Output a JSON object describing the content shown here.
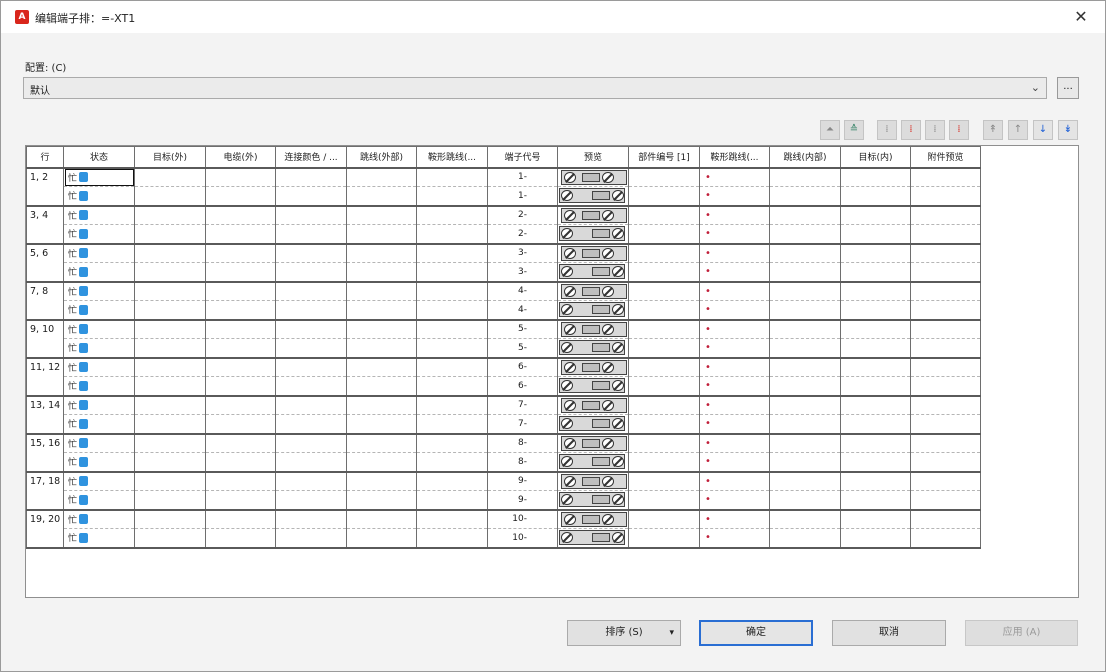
{
  "window": {
    "title": "编辑端子排：=-XT1",
    "app_icon_glyph": "A",
    "close_glyph": "✕"
  },
  "config": {
    "label": "配置: (C)",
    "selected": "默认",
    "chevron": "⌄",
    "more_label": "..."
  },
  "toolbar": [
    {
      "name": "move-top-icon",
      "glyph": "⏶",
      "tone": "gray"
    },
    {
      "name": "align-icon",
      "glyph": "≙",
      "tone": "teal"
    },
    {
      "name": "split-col-icon",
      "glyph": "⁞",
      "tone": "gray"
    },
    {
      "name": "insert-red-icon",
      "glyph": "⁞",
      "tone": "red"
    },
    {
      "name": "column-icon",
      "glyph": "⁞",
      "tone": "gray"
    },
    {
      "name": "delete-red-icon",
      "glyph": "⁞",
      "tone": "red"
    },
    {
      "name": "up-first-icon",
      "glyph": "↟",
      "tone": "gray"
    },
    {
      "name": "up-icon",
      "glyph": "↑",
      "tone": "gray"
    },
    {
      "name": "down-icon",
      "glyph": "↓",
      "tone": "blue"
    },
    {
      "name": "down-last-icon",
      "glyph": "↡",
      "tone": "blue"
    }
  ],
  "table": {
    "headers": [
      "行",
      "状态",
      "目标(外)",
      "电缆(外)",
      "连接颜色 / ...",
      "跳线(外部)",
      "鞍形跳线(...",
      "端子代号",
      "预览",
      "部件编号 [1]",
      "鞍形跳线(...",
      "跳线(内部)",
      "目标(内)",
      "附件预览"
    ],
    "status_glyph": "忙",
    "dot_glyph": "•",
    "rows": [
      {
        "label": "1, 2",
        "codes": [
          "1-",
          "1-"
        ]
      },
      {
        "label": "3, 4",
        "codes": [
          "2-",
          "2-"
        ]
      },
      {
        "label": "5, 6",
        "codes": [
          "3-",
          "3-"
        ]
      },
      {
        "label": "7, 8",
        "codes": [
          "4-",
          "4-"
        ]
      },
      {
        "label": "9, 10",
        "codes": [
          "5-",
          "5-"
        ]
      },
      {
        "label": "11, 12",
        "codes": [
          "6-",
          "6-"
        ]
      },
      {
        "label": "13, 14",
        "codes": [
          "7-",
          "7-"
        ]
      },
      {
        "label": "15, 16",
        "codes": [
          "8-",
          "8-"
        ]
      },
      {
        "label": "17, 18",
        "codes": [
          "9-",
          "9-"
        ]
      },
      {
        "label": "19, 20",
        "codes": [
          "10-",
          "10-"
        ]
      }
    ]
  },
  "buttons": {
    "sort": "排序 (S)",
    "sort_arrow": "▾",
    "ok": "确定",
    "cancel": "取消",
    "apply": "应用 (A)"
  }
}
